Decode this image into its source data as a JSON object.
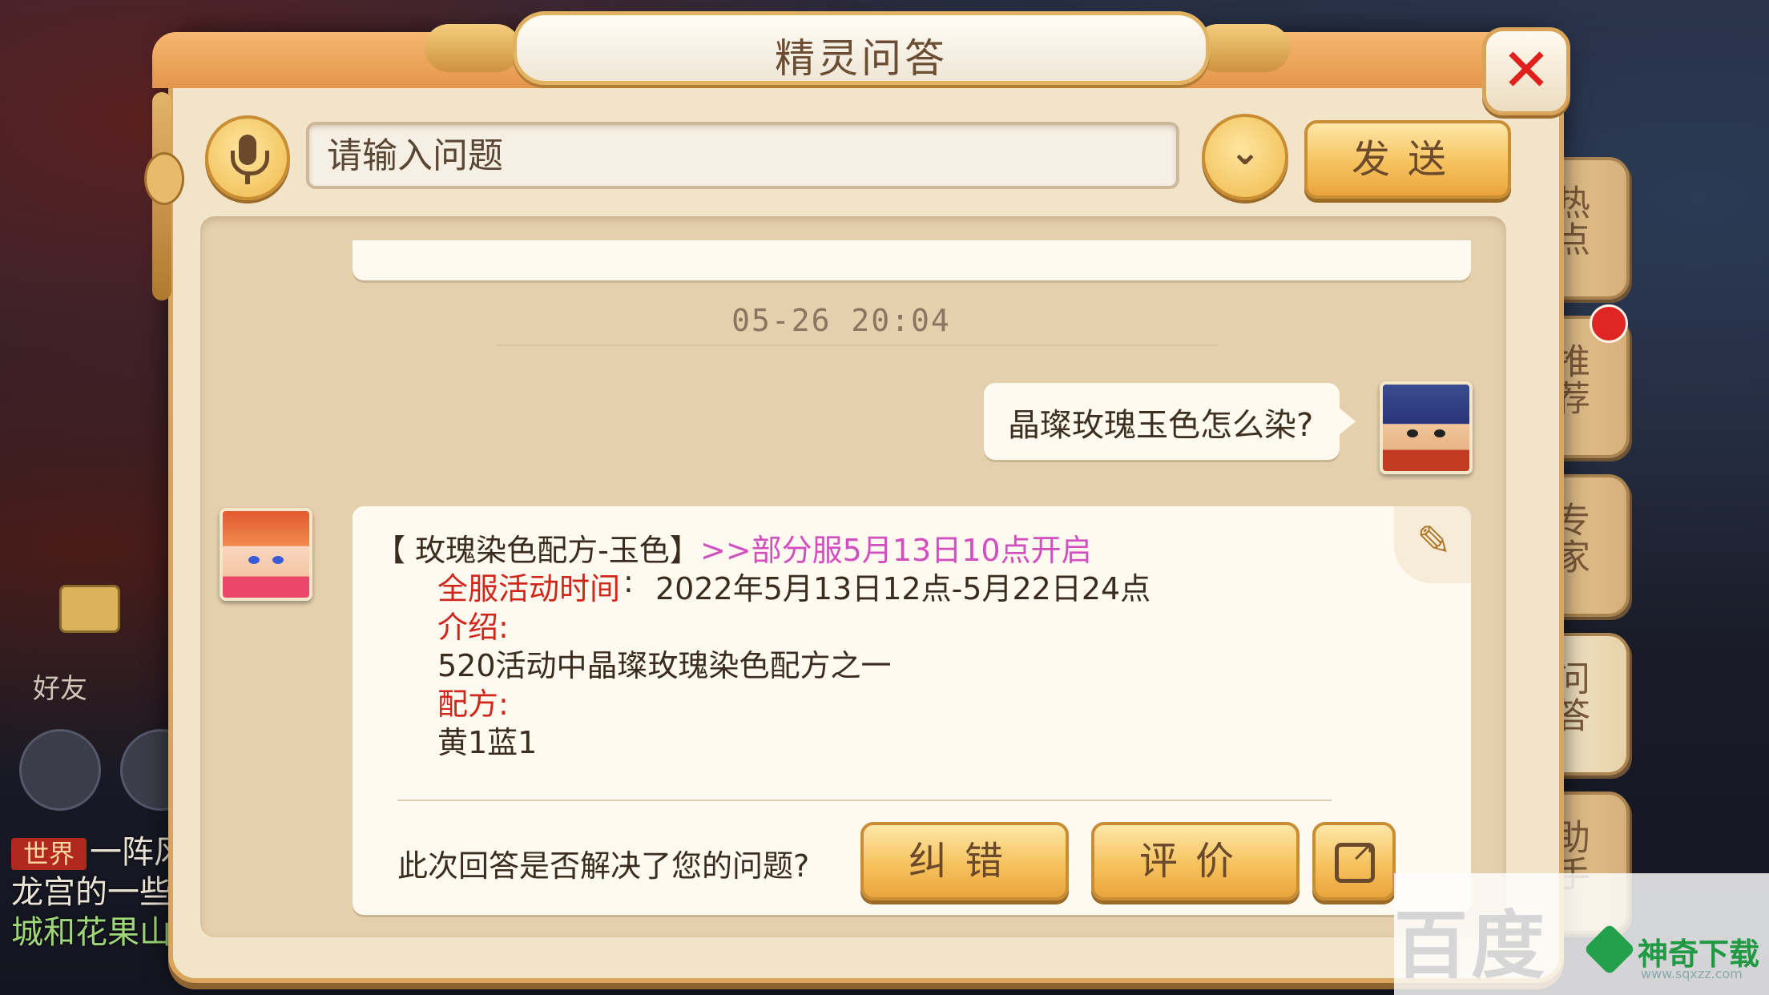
{
  "dialog": {
    "title": "精灵问答",
    "close_label": "✕"
  },
  "input": {
    "placeholder": "请输入问题",
    "send_label": "发送",
    "dropdown_glyph": "⌄"
  },
  "side_tabs": [
    {
      "label": "热点"
    },
    {
      "label": "推荐"
    },
    {
      "label": "专家"
    },
    {
      "label": "问答"
    },
    {
      "label": "助手"
    }
  ],
  "chat": {
    "timestamp": "05-26 20:04",
    "user_question": "晶璨玫瑰玉色怎么染?",
    "answer": {
      "bracket_title": "【 玫瑰染色配方-玉色】",
      "server_note": ">>部分服5月13日10点开启",
      "activity_label": "全服活动时间",
      "activity_colon": ":",
      "activity_time": "2022年5月13日12点-5月22日24点",
      "intro_label": "介绍:",
      "intro_text": "520活动中晶璨玫瑰染色配方之一",
      "recipe_label": "配方:",
      "recipe_text": "黄1蓝1"
    },
    "feedback_question": "此次回答是否解决了您的问题?",
    "correct_label": "纠错",
    "rate_label": "评价"
  },
  "background": {
    "friends_label": "好友",
    "chat_line1": "一阵风",
    "chat_tag": "世界",
    "chat_line2": "龙宫的一些",
    "chat_line3": "城和花果山"
  },
  "watermark": {
    "baidu": "百度",
    "brand": "神奇下载",
    "url": "www.sqxzz.com"
  },
  "colors": {
    "accent_gold": "#f6c25e",
    "title_brown": "#6a4d33",
    "highlight_red": "#d0261c",
    "highlight_pink": "#d14fbf",
    "notification_red": "#e02525"
  }
}
